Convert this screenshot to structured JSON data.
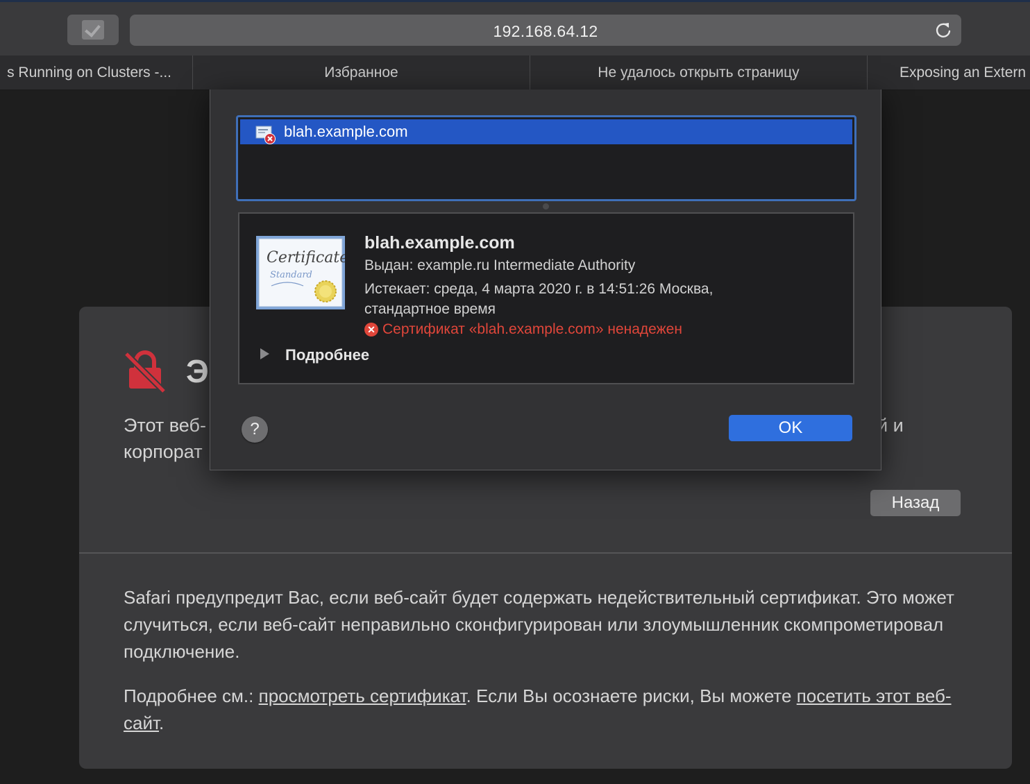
{
  "toolbar": {
    "url": "192.168.64.12",
    "extension_icon": "checkbox-icon",
    "reload_icon": "reload-icon"
  },
  "tabs": [
    {
      "label": "s Running on Clusters -..."
    },
    {
      "label": "Избранное"
    },
    {
      "label": "Не удалось открыть страницу"
    },
    {
      "label": "Exposing an Extern"
    }
  ],
  "page": {
    "title_fragment": "Э",
    "desc_left_line1": "Этот веб-",
    "desc_left_line2": "корпорат",
    "desc_right": "й и",
    "back_button": "Назад",
    "info_paragraph": "Safari предупредит Вас, если веб-сайт будет содержать недействительный сертификат. Это может случиться, если веб-сайт неправильно сконфигурирован или злоумышленник скомпрометировал подключение.",
    "info2_prefix": "Подробнее см.: ",
    "view_cert_link": "просмотреть сертификат",
    "info2_middle": ". Если Вы осознаете риски, Вы можете ",
    "visit_link": "посетить этот веб-сайт",
    "info2_suffix": ".",
    "lock_icon": "broken-lock-icon",
    "accent_color": "#d0313c"
  },
  "dialog": {
    "list_items": [
      {
        "label": "blah.example.com"
      }
    ],
    "cert_name": "blah.example.com",
    "issuer": "Выдан: example.ru Intermediate Authority",
    "expires": "Истекает: среда, 4 марта 2020 г. в 14:51:26 Москва, стандартное время",
    "warning": "Сертификат «blah.example.com» ненадежен",
    "details_toggle": "Подробнее",
    "help_button": "?",
    "ok_button": "OK",
    "cert_image_text_1": "Certificate",
    "cert_image_text_2": "Standard",
    "selection_color": "#2457c4",
    "warning_color": "#e0463a",
    "ok_color": "#2f6fde"
  }
}
